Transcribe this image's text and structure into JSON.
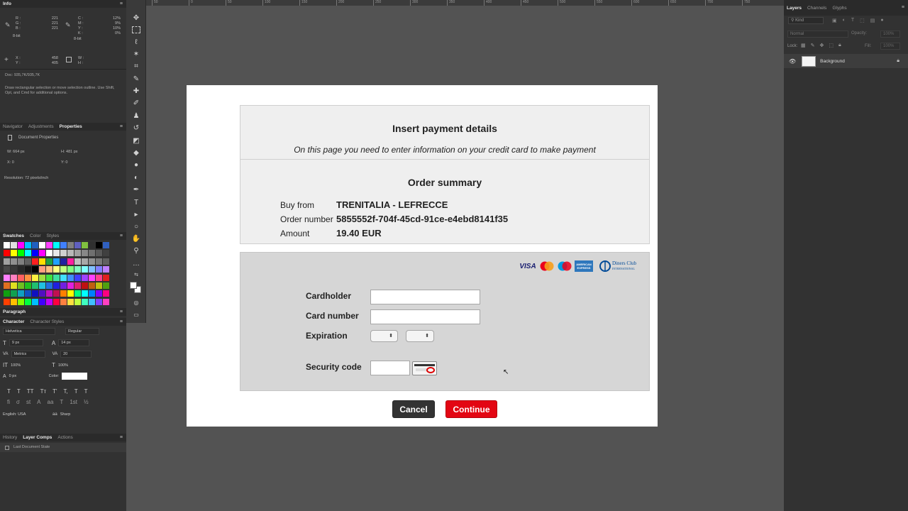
{
  "colors": {
    "workspace": "#535353",
    "panel": "#323232",
    "cancel_button": "#333333",
    "continue_button": "#e30613"
  },
  "info_panel": {
    "tab": "Info",
    "rgb": {
      "R": "221",
      "G": "221",
      "B": "221"
    },
    "cmyk": {
      "C": "12%",
      "M": "9%",
      "Y": "10%",
      "K": "0%"
    },
    "bit_left": "8-bit",
    "bit_right": "8-bit",
    "xy": {
      "X": "458",
      "Y": "405"
    },
    "wh": {
      "W": "",
      "H": ""
    },
    "doc": "Doc: 935,7K/935,7K",
    "hint": "Draw rectangular selection or move selection outline. Use Shift, Opt, and Cmd for additional options."
  },
  "properties_panel": {
    "tabs": [
      "Navigator",
      "Adjustments",
      "Properties"
    ],
    "title": "Document Properties",
    "w": "W:  664 px",
    "h": "H:  481 px",
    "x": "X:  0",
    "y": "Y:  0",
    "resolution": "Resolution: 72 pixels/inch"
  },
  "swatches_panel": {
    "tabs": [
      "Swatches",
      "Color",
      "Styles"
    ]
  },
  "paragraph_panel": {
    "tab": "Paragraph"
  },
  "character_panel": {
    "tabs": [
      "Character",
      "Character Styles"
    ],
    "font_family": "Helvetica",
    "font_style": "Regular",
    "font_size": "9 px",
    "leading": "14 px",
    "kerning": "Metrics",
    "tracking": "20",
    "vertical_scale": "100%",
    "horizontal_scale": "100%",
    "baseline": "0 px",
    "color_label": "Color:",
    "language": "English: USA",
    "antialias": "Sharp",
    "type_buttons": [
      "T",
      "T",
      "TT",
      "Tт",
      "T'",
      "T,",
      "T",
      "T"
    ],
    "ot_buttons": [
      "fi",
      "σ",
      "st",
      "A",
      "aa",
      "T",
      "1st",
      "½"
    ]
  },
  "history_panel": {
    "tabs": [
      "History",
      "Layer Comps",
      "Actions"
    ],
    "item": "Last Document State"
  },
  "ruler": {
    "ticks": [
      "50",
      "0",
      "50",
      "100",
      "150",
      "200",
      "250",
      "300",
      "350",
      "400",
      "450",
      "500",
      "550",
      "600",
      "650",
      "700",
      "750"
    ]
  },
  "layers_panel": {
    "tabs": [
      "Layers",
      "Channels",
      "Glyphs"
    ],
    "filter": "Kind",
    "blend_mode": "Normal",
    "opacity_label": "Opacity:",
    "opacity": "100%",
    "lock_label": "Lock:",
    "fill_label": "Fill:",
    "fill": "100%",
    "layer_name": "Background"
  },
  "payment": {
    "title": "Insert payment details",
    "subtitle": "On this page you need to enter information on your credit card to make payment",
    "summary_title": "Order summary",
    "buy_from_label": "Buy from",
    "buy_from": "TRENITALIA - LEFRECCE",
    "order_number_label": "Order number",
    "order_number": "5855552f-704f-45cd-91ce-e4ebd8141f35",
    "amount_label": "Amount",
    "amount": "19.40 EUR",
    "card_logos": [
      "VISA",
      "MasterCard",
      "Maestro",
      "AMERICAN EXPRESS",
      "Diners Club INTERNATIONAL"
    ],
    "cardholder_label": "Cardholder",
    "cardholder_value": "",
    "card_number_label": "Card number",
    "card_number_value": "",
    "expiration_label": "Expiration",
    "security_code_label": "Security code",
    "security_code_value": "",
    "cancel": "Cancel",
    "continue": "Continue"
  }
}
